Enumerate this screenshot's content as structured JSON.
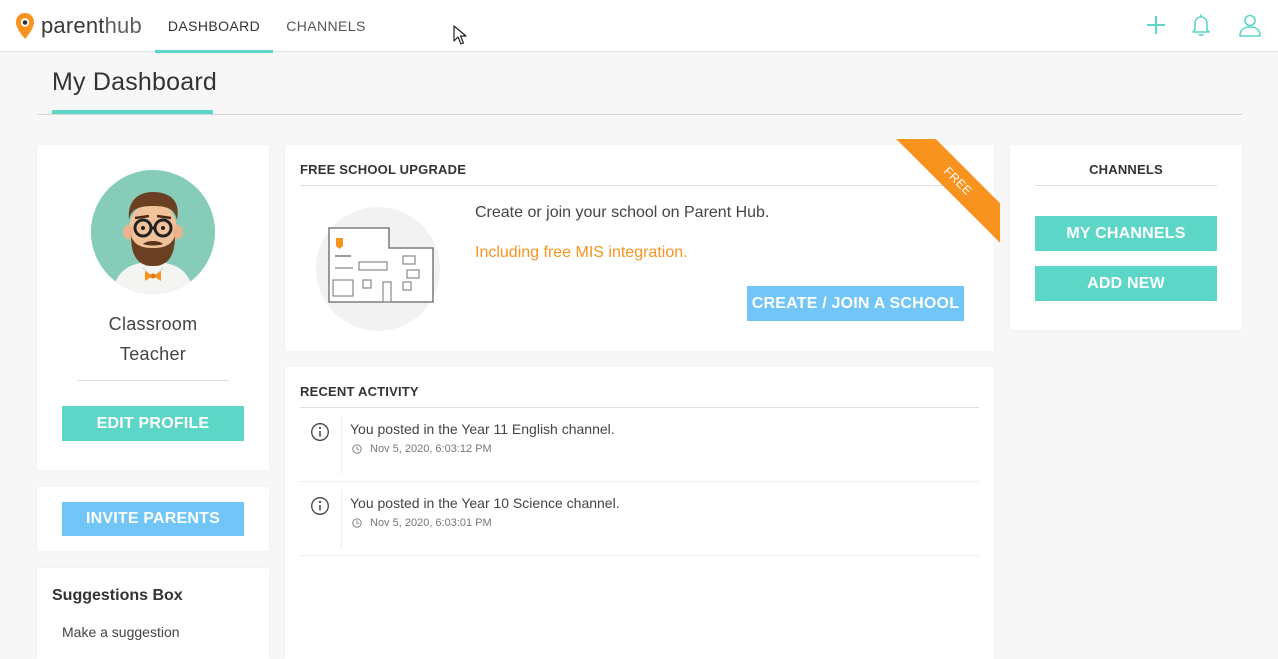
{
  "app": {
    "logo_part1": "parent",
    "logo_part2": "hub"
  },
  "nav": {
    "tabs": [
      {
        "label": "DASHBOARD",
        "active": true
      },
      {
        "label": "CHANNELS",
        "active": false
      }
    ],
    "icons": [
      "plus-icon",
      "bell-icon",
      "user-icon"
    ]
  },
  "page": {
    "title": "My Dashboard"
  },
  "profile": {
    "role_line1": "Classroom",
    "role_line2": "Teacher",
    "edit_label": "EDIT PROFILE"
  },
  "invite": {
    "label": "INVITE PARENTS"
  },
  "suggestions": {
    "heading": "Suggestions Box",
    "link": "Make a suggestion"
  },
  "upgrade": {
    "heading": "FREE SCHOOL UPGRADE",
    "ribbon": "FREE",
    "line1": "Create or join your school on Parent Hub.",
    "line2": "Including free MIS integration.",
    "button": "CREATE / JOIN A SCHOOL"
  },
  "activity": {
    "heading": "RECENT ACTIVITY",
    "items": [
      {
        "text": "You posted in the Year 11 English channel.",
        "time": "Nov 5, 2020, 6:03:12 PM"
      },
      {
        "text": "You posted in the Year 10 Science channel.",
        "time": "Nov 5, 2020, 6:03:01 PM"
      }
    ]
  },
  "channels": {
    "heading": "CHANNELS",
    "my_channels": "MY CHANNELS",
    "add_new": "ADD NEW"
  },
  "colors": {
    "teal": "#5cd6c6",
    "blue": "#71c5f7",
    "orange": "#f7931e",
    "page_bg": "#f7f7f7"
  }
}
